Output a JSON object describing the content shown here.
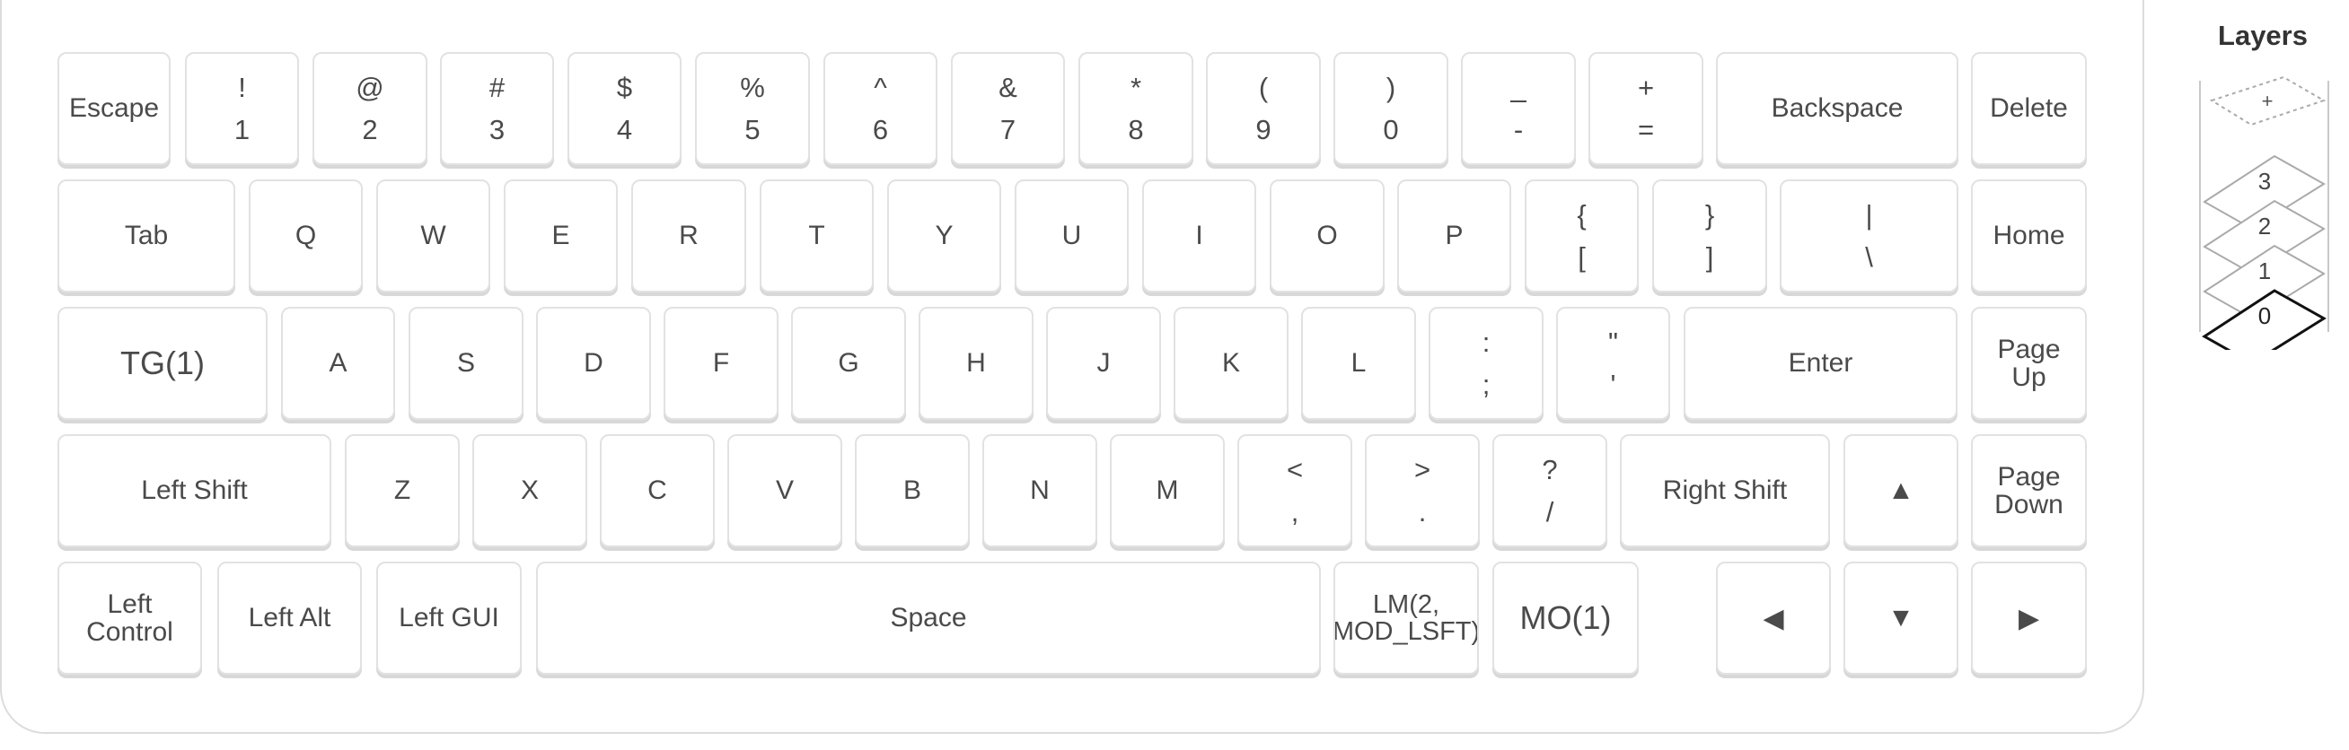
{
  "keyboard": {
    "rows": [
      [
        {
          "id": "escape",
          "label": "Escape"
        },
        {
          "id": "1",
          "shift": "!",
          "base": "1"
        },
        {
          "id": "2",
          "shift": "@",
          "base": "2"
        },
        {
          "id": "3",
          "shift": "#",
          "base": "3"
        },
        {
          "id": "4",
          "shift": "$",
          "base": "4"
        },
        {
          "id": "5",
          "shift": "%",
          "base": "5"
        },
        {
          "id": "6",
          "shift": "^",
          "base": "6"
        },
        {
          "id": "7",
          "shift": "&",
          "base": "7"
        },
        {
          "id": "8",
          "shift": "*",
          "base": "8"
        },
        {
          "id": "9",
          "shift": "(",
          "base": "9"
        },
        {
          "id": "0",
          "shift": ")",
          "base": "0"
        },
        {
          "id": "minus",
          "shift": "_",
          "base": "-"
        },
        {
          "id": "equal",
          "shift": "+",
          "base": "="
        },
        {
          "id": "backspace",
          "label": "Backspace"
        },
        {
          "id": "delete",
          "label": "Delete"
        }
      ],
      [
        {
          "id": "tab",
          "label": "Tab"
        },
        {
          "id": "q",
          "label": "Q"
        },
        {
          "id": "w",
          "label": "W"
        },
        {
          "id": "e",
          "label": "E"
        },
        {
          "id": "r",
          "label": "R"
        },
        {
          "id": "t",
          "label": "T"
        },
        {
          "id": "y",
          "label": "Y"
        },
        {
          "id": "u",
          "label": "U"
        },
        {
          "id": "i",
          "label": "I"
        },
        {
          "id": "o",
          "label": "O"
        },
        {
          "id": "p",
          "label": "P"
        },
        {
          "id": "lbracket",
          "shift": "{",
          "base": "["
        },
        {
          "id": "rbracket",
          "shift": "}",
          "base": "]"
        },
        {
          "id": "backslash",
          "shift": "|",
          "base": "\\"
        },
        {
          "id": "home",
          "label": "Home"
        }
      ],
      [
        {
          "id": "tg1",
          "label": "TG(1)"
        },
        {
          "id": "a",
          "label": "A"
        },
        {
          "id": "s",
          "label": "S"
        },
        {
          "id": "d",
          "label": "D"
        },
        {
          "id": "f",
          "label": "F"
        },
        {
          "id": "g",
          "label": "G"
        },
        {
          "id": "h",
          "label": "H"
        },
        {
          "id": "j",
          "label": "J"
        },
        {
          "id": "k",
          "label": "K"
        },
        {
          "id": "l",
          "label": "L"
        },
        {
          "id": "semicolon",
          "shift": ":",
          "base": ";"
        },
        {
          "id": "quote",
          "shift": "\"",
          "base": "'"
        },
        {
          "id": "enter",
          "label": "Enter"
        },
        {
          "id": "page-up",
          "label": "Page\nUp"
        }
      ],
      [
        {
          "id": "left-shift",
          "label": "Left Shift"
        },
        {
          "id": "z",
          "label": "Z"
        },
        {
          "id": "x",
          "label": "X"
        },
        {
          "id": "c",
          "label": "C"
        },
        {
          "id": "v",
          "label": "V"
        },
        {
          "id": "b",
          "label": "B"
        },
        {
          "id": "n",
          "label": "N"
        },
        {
          "id": "m",
          "label": "M"
        },
        {
          "id": "comma",
          "shift": "<",
          "base": ","
        },
        {
          "id": "period",
          "shift": ">",
          "base": "."
        },
        {
          "id": "slash",
          "shift": "?",
          "base": "/"
        },
        {
          "id": "right-shift",
          "label": "Right Shift"
        },
        {
          "id": "up-arrow",
          "glyph": "▲"
        },
        {
          "id": "page-down",
          "label": "Page\nDown"
        }
      ],
      [
        {
          "id": "left-control",
          "label": "Left\nControl"
        },
        {
          "id": "left-alt",
          "label": "Left Alt"
        },
        {
          "id": "left-gui",
          "label": "Left GUI"
        },
        {
          "id": "space",
          "label": "Space"
        },
        {
          "id": "lm2",
          "label": "LM(2,\nMOD_LSFT)"
        },
        {
          "id": "mo1",
          "label": "MO(1)"
        },
        {
          "id": "left-arrow",
          "glyph": "◀"
        },
        {
          "id": "down-arrow",
          "glyph": "▼"
        },
        {
          "id": "right-arrow",
          "glyph": "▶"
        }
      ]
    ]
  },
  "layers": {
    "title": "Layers",
    "add_label": "+",
    "items": [
      "3",
      "2",
      "1",
      "0"
    ],
    "active": "0"
  }
}
